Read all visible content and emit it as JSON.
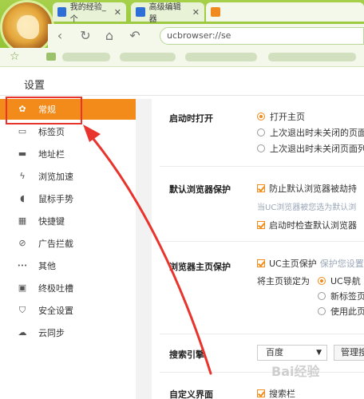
{
  "browser": {
    "tabs": [
      {
        "label": "我的经验_个"
      },
      {
        "label": "高级编辑器"
      },
      {
        "label": ""
      }
    ],
    "address": "ucbrowser://se",
    "nav_icons": [
      "back-icon",
      "refresh-icon",
      "home-icon",
      "undo-icon"
    ]
  },
  "settings": {
    "title": "设置",
    "sidebar": [
      {
        "label": "常规",
        "icon": "gear-icon",
        "glyph": "✿"
      },
      {
        "label": "标签页",
        "icon": "tab-icon",
        "glyph": "▭"
      },
      {
        "label": "地址栏",
        "icon": "address-bar-icon",
        "glyph": "▬"
      },
      {
        "label": "浏览加速",
        "icon": "lightning-icon",
        "glyph": "ϟ"
      },
      {
        "label": "鼠标手势",
        "icon": "mouse-icon",
        "glyph": "◖"
      },
      {
        "label": "快捷键",
        "icon": "keyboard-icon",
        "glyph": "▦"
      },
      {
        "label": "广告拦截",
        "icon": "block-icon",
        "glyph": "⊘"
      },
      {
        "label": "其他",
        "icon": "more-icon",
        "glyph": "•••"
      },
      {
        "label": "终极吐槽",
        "icon": "feedback-icon",
        "glyph": "▣"
      },
      {
        "label": "安全设置",
        "icon": "shield-icon",
        "glyph": "⛉"
      },
      {
        "label": "云同步",
        "icon": "cloud-icon",
        "glyph": "☁"
      }
    ],
    "startup": {
      "label": "启动时打开",
      "options": [
        "打开主页",
        "上次退出时未关闭的页面",
        "上次退出时未关闭页面列"
      ]
    },
    "default_protect": {
      "label": "默认浏览器保护",
      "prevent": "防止默认浏览器被劫持",
      "hint": "当UC浏览器被您选为默认浏",
      "check_on_start": "启动时检查默认浏览器"
    },
    "home_protect": {
      "label": "浏览器主页保护",
      "uc_protect": "UC主页保护",
      "hint": "保护您设置的",
      "lock_label": "将主页锁定为",
      "options": [
        "UC导航",
        "新标签页",
        "使用此页"
      ]
    },
    "search": {
      "label": "搜索引擎",
      "engine": "百度",
      "manage": "管理搜"
    },
    "custom": {
      "label": "自定义界面",
      "search_bar": "搜索栏"
    }
  },
  "watermark": "Bai经验"
}
